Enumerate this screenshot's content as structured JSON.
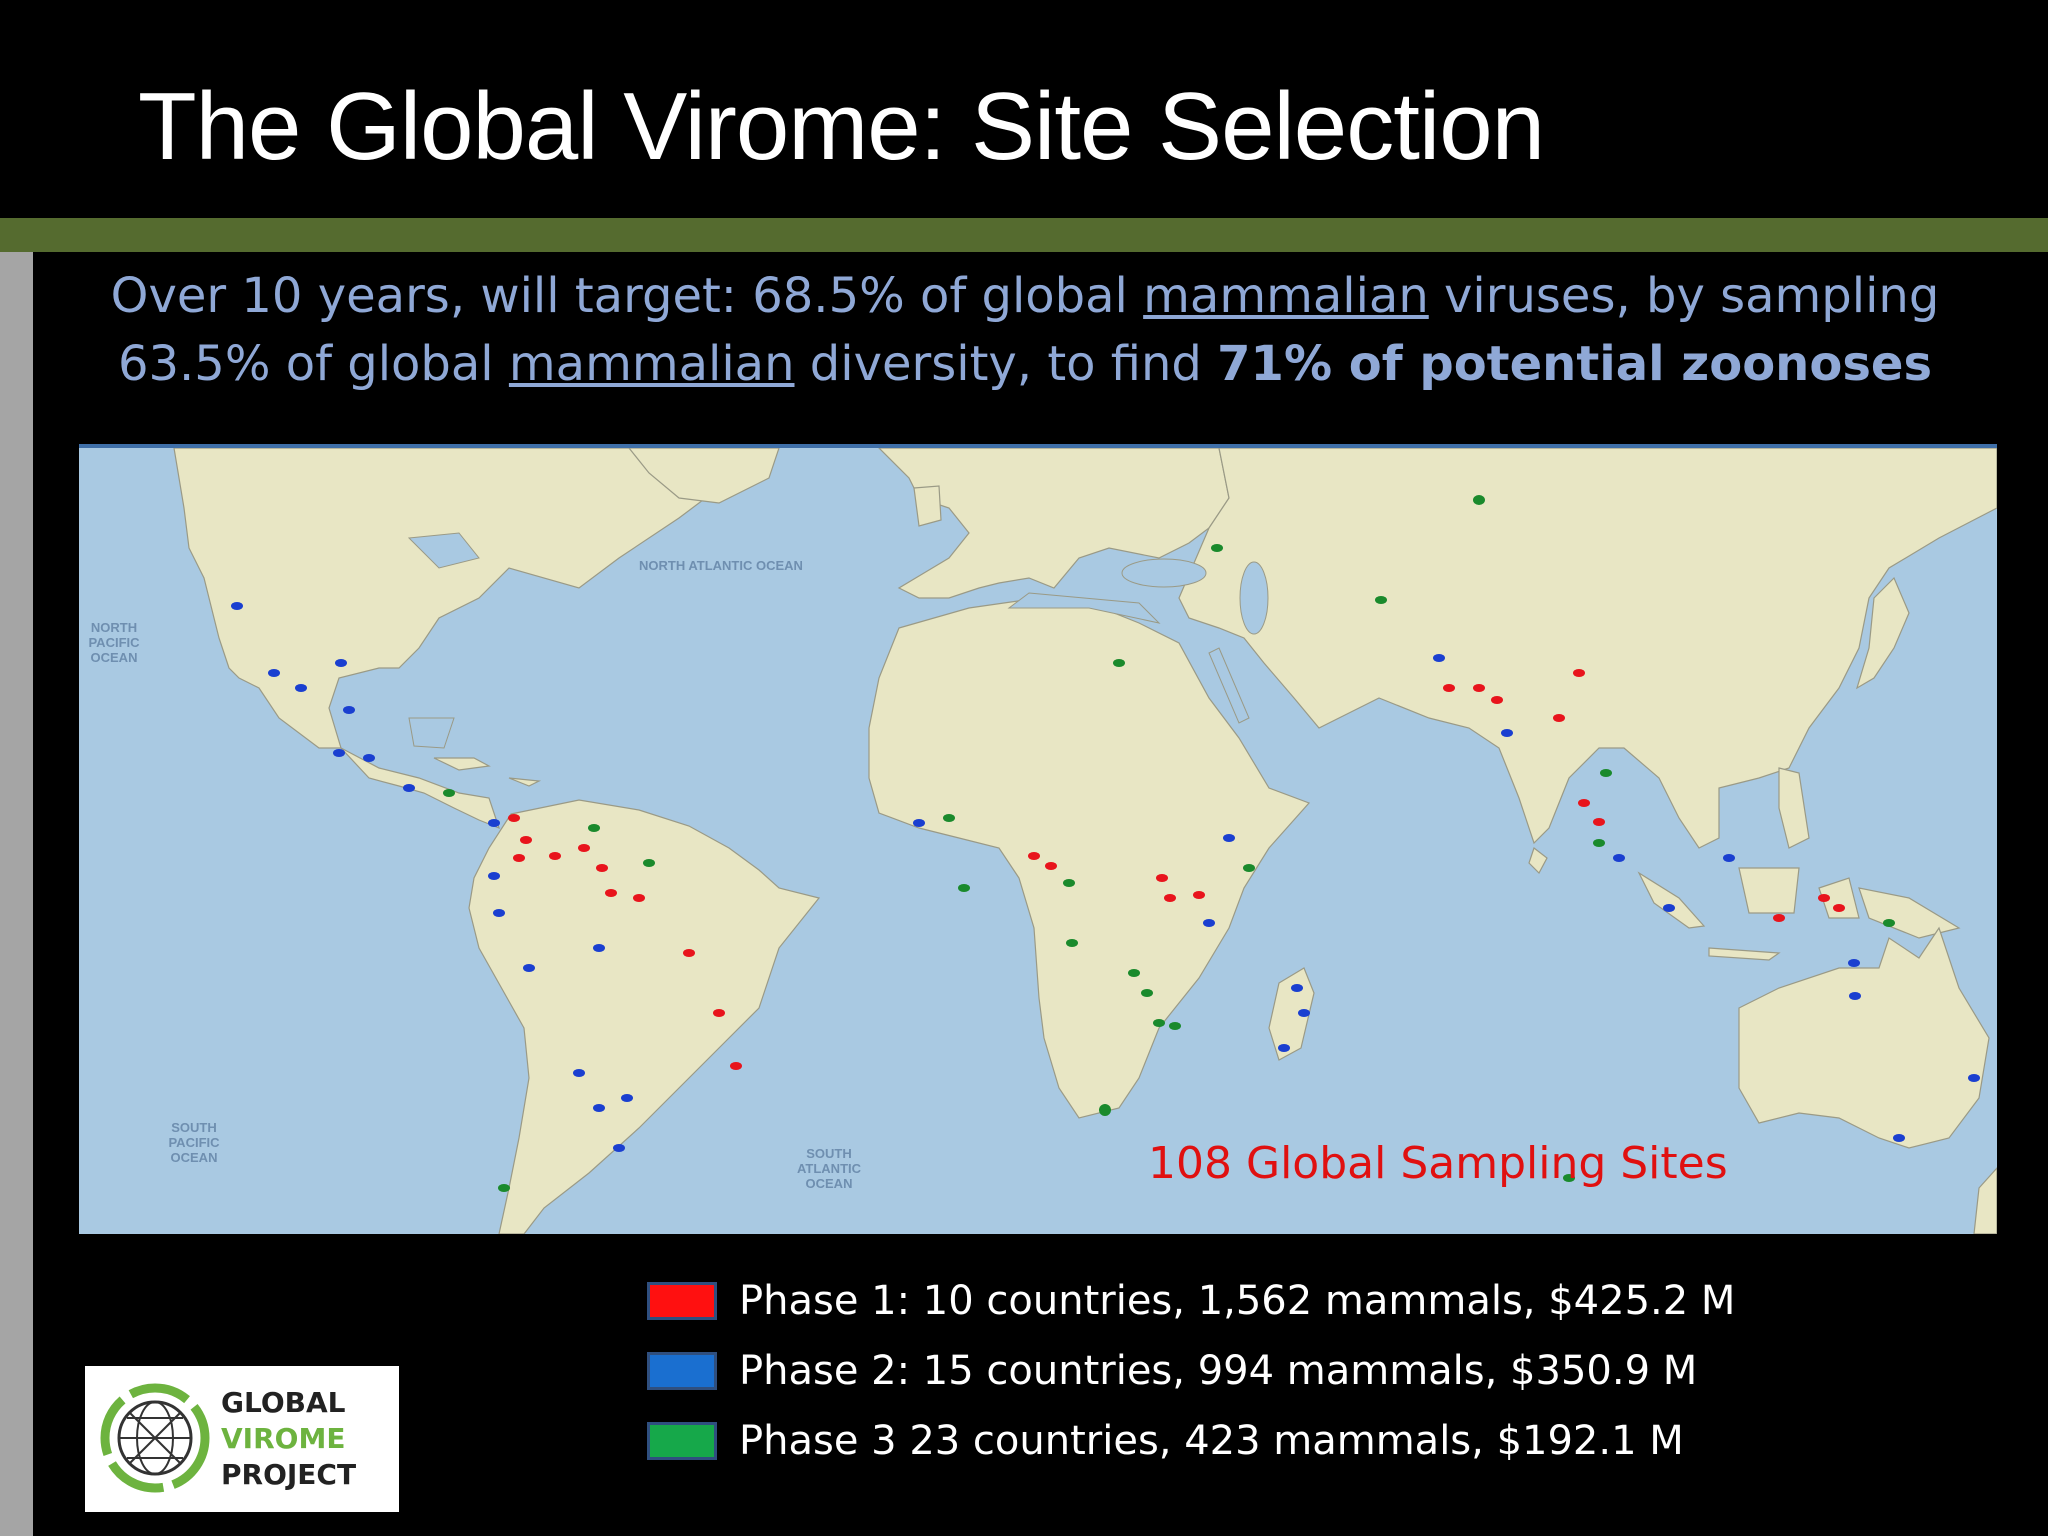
{
  "slide": {
    "title": "The Global Virome:  Site Selection",
    "subtitle": {
      "l1_a": "Over 10 years, will target:  68.5% of global ",
      "l1_u": "mammalian",
      "l1_b": " viruses, by sampling",
      "l2_a": "63.5% of global ",
      "l2_u": "mammalian",
      "l2_b": " diversity, to find ",
      "l2_bold": "71% of potential zoonoses"
    }
  },
  "map": {
    "annotation": "108 Global Sampling Sites",
    "ocean_labels": {
      "north_atlantic": "NORTH ATLANTIC OCEAN",
      "north_pacific": "NORTH PACIFIC OCEAN",
      "south_pacific": "SOUTH PACIFIC OCEAN",
      "south_atlantic": "SOUTH ATLANTIC OCEAN"
    },
    "colors": {
      "ocean": "#a9c9e2",
      "land": "#e8e6c4",
      "phase1": "#e8141c",
      "phase2": "#1a3fd0",
      "phase3": "#1a8a2c"
    }
  },
  "legend": [
    {
      "label": "Phase 1: 10 countries, 1,562 mammals, $425.2 M",
      "color": "#ff1010"
    },
    {
      "label": "Phase 2: 15 countries, 994 mammals, $350.9 M",
      "color": "#1a6fd0"
    },
    {
      "label": "Phase 3 23 countries, 423 mammals, $192.1 M",
      "color": "#16a84a"
    }
  ],
  "logo": {
    "line1": "GLOBAL",
    "line2": "VIROME",
    "line3": "PROJECT",
    "icon": "globe-network-icon"
  }
}
